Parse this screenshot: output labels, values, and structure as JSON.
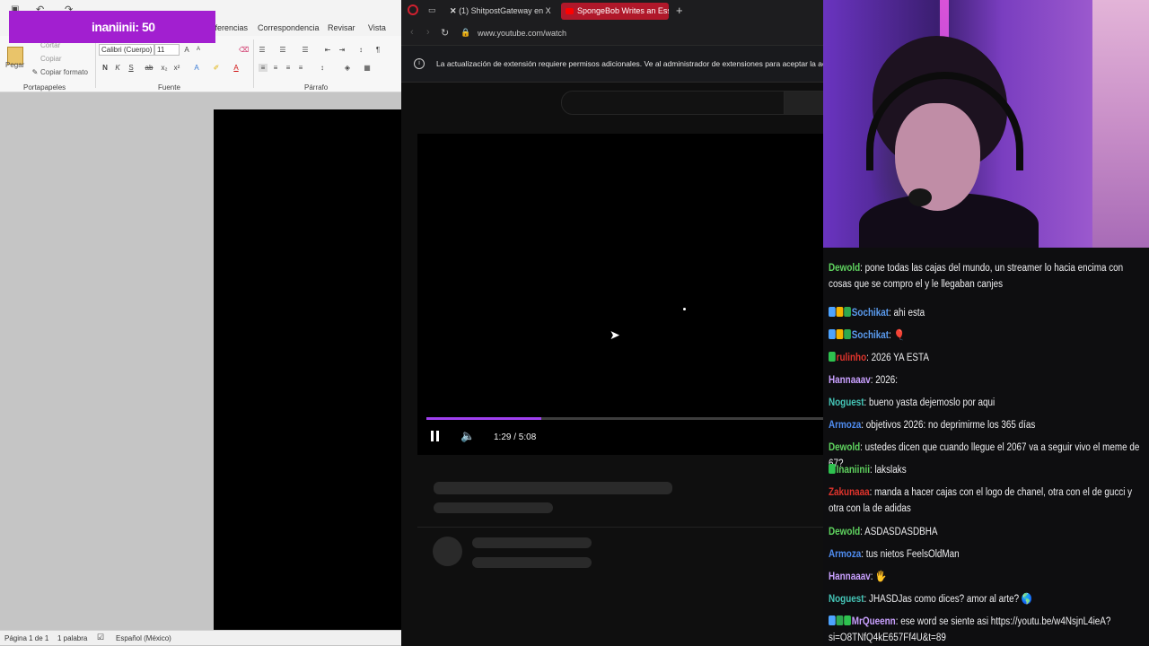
{
  "points_overlay": {
    "text": "inaniinii: 50"
  },
  "word": {
    "tabs": [
      "Referencias",
      "Correspondencia",
      "Revisar",
      "Vista"
    ],
    "clipboard": {
      "paste": "Pegar",
      "cut": "Cortar",
      "copy": "Copiar",
      "format_painter": "Copiar formato",
      "group": "Portapapeles"
    },
    "font": {
      "name": "Calibri (Cuerpo)",
      "size": "11",
      "group": "Fuente"
    },
    "paragraph": {
      "group": "Párrafo"
    },
    "status": {
      "page": "Página 1 de 1",
      "words": "1 palabra",
      "language": "Español (México)"
    }
  },
  "browser": {
    "tabs": [
      {
        "label": "(1) ShitpostGateway en X",
        "active": false
      },
      {
        "label": "SpongeBob Writes an Essay",
        "active": true
      }
    ],
    "new_tab": "+",
    "url": "www.youtube.com/watch",
    "notice": "La actualización de extensión requiere permisos adicionales. Ve al administrador de extensiones para aceptar la actualización.",
    "player": {
      "time": "1:29 / 5:08",
      "progress_fraction": 0.29,
      "accent": "#a040f0"
    }
  },
  "chat": {
    "cut_top": "",
    "messages": [
      {
        "user": "Dewold",
        "color": "#5fd35f",
        "badges": [],
        "text": "pone todas las cajas del mundo, un streamer lo hacia encima con cosas que se compro el y le llegaban canjes"
      },
      {
        "user": "Sochikat",
        "color": "#5b9cf0",
        "badges": [
          "pin",
          "crown",
          "sub"
        ],
        "text": "ahi esta"
      },
      {
        "user": "Sochikat",
        "color": "#5b9cf0",
        "badges": [
          "pin",
          "crown",
          "sub"
        ],
        "text": "🎈"
      },
      {
        "user": "rulinho",
        "color": "#e0342c",
        "badges": [
          "gem"
        ],
        "text": "2026 YA ESTA"
      },
      {
        "user": "Hannaaav",
        "color": "#c9a0ff",
        "badges": [],
        "text": "2026:"
      },
      {
        "user": "Noguest",
        "color": "#45c6b8",
        "badges": [],
        "text": "bueno yasta dejemoslo por aqui"
      },
      {
        "user": "Armoza",
        "color": "#4f8cf0",
        "badges": [],
        "text": "objetivos 2026: no deprimirme los 365 días"
      },
      {
        "user": "Dewold",
        "color": "#5fd35f",
        "badges": [],
        "text": "ustedes dicen que cuando llegue el 2067 va a seguir vivo el meme de 67?"
      },
      {
        "user": "Inaniinii",
        "color": "#5fd35f",
        "badges": [
          "gem"
        ],
        "text": "lakslaks"
      },
      {
        "user": "Zakunaaa",
        "color": "#e0342c",
        "badges": [],
        "text": "manda a hacer cajas con el logo de chanel, otra con el de gucci y otra con la de adidas"
      },
      {
        "user": "Dewold",
        "color": "#5fd35f",
        "badges": [],
        "text": "ASDASDASDBHA"
      },
      {
        "user": "Armoza",
        "color": "#4f8cf0",
        "badges": [],
        "text": "tus nietos FeelsOldMan"
      },
      {
        "user": "Hannaaav",
        "color": "#c9a0ff",
        "badges": [],
        "text": "🖐"
      },
      {
        "user": "Noguest",
        "color": "#45c6b8",
        "badges": [],
        "text": "JHASDJas como dices? amor al arte? 🌎"
      },
      {
        "user": "MrQueenn",
        "color": "#c9a0ff",
        "badges": [
          "pin",
          "sub",
          "gem"
        ],
        "text": "ese word se siente asi https://youtu.be/w4NsjnL4ieA?si=O8TNfQ4kE657Ff4U&t=89"
      }
    ]
  }
}
